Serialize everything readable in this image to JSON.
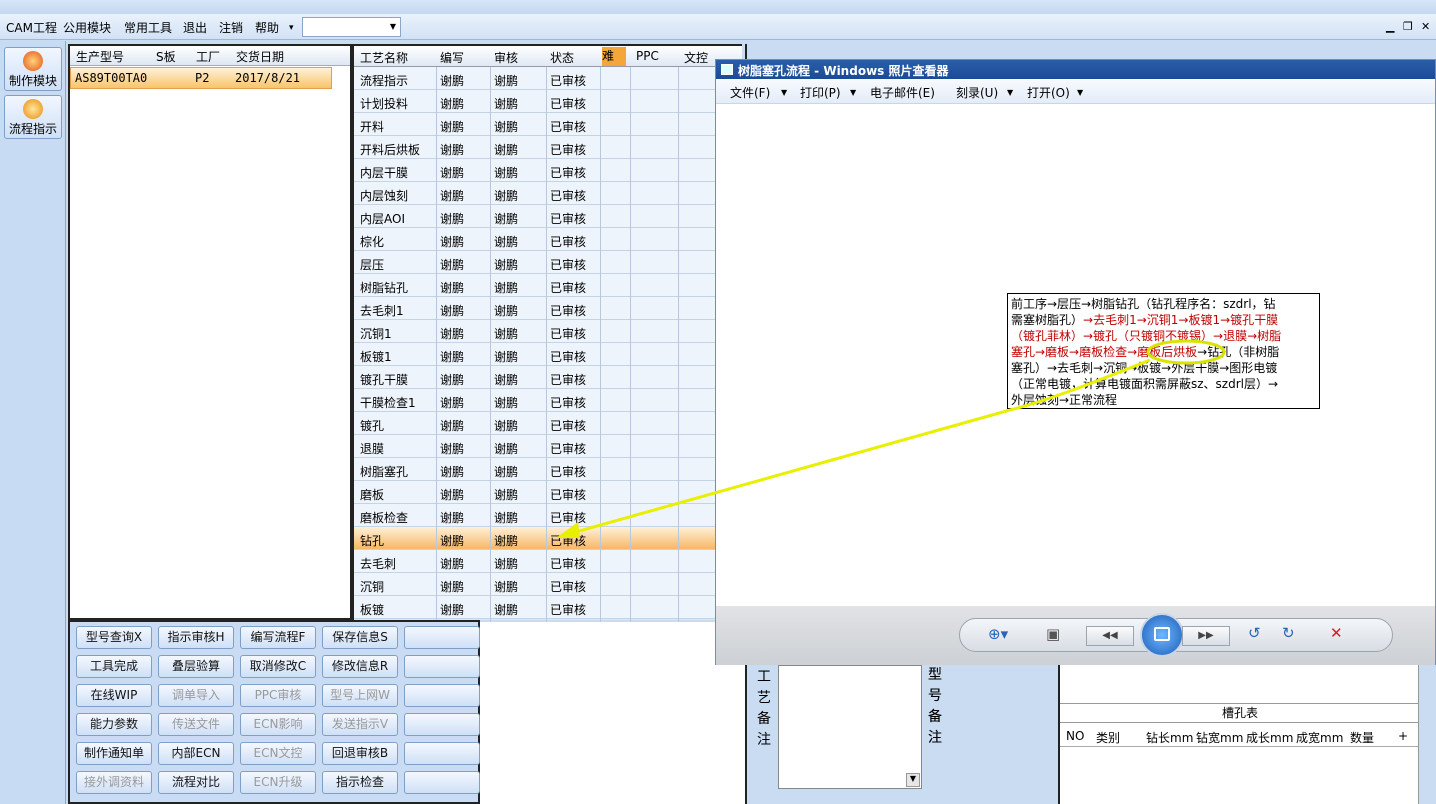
{
  "menubar": {
    "items": [
      "CAM工程",
      "公用模块",
      "常用工具",
      "退出",
      "注销",
      "帮助"
    ]
  },
  "rail": {
    "buttons": [
      "制作模块",
      "流程指示"
    ]
  },
  "orders": {
    "headers": [
      "生产型号",
      "S板",
      "工厂",
      "交货日期"
    ],
    "row": {
      "model": "AS89T00TA0",
      "factory": "P2",
      "date": "2017/8/21"
    }
  },
  "process": {
    "headers": [
      "工艺名称",
      "编写",
      "审核",
      "状态",
      "难",
      "PPC",
      "文控"
    ],
    "rows": [
      {
        "name": "流程指示",
        "writer": "谢鹏",
        "reviewer": "谢鹏",
        "status": "已审核"
      },
      {
        "name": "计划投料",
        "writer": "谢鹏",
        "reviewer": "谢鹏",
        "status": "已审核"
      },
      {
        "name": "开料",
        "writer": "谢鹏",
        "reviewer": "谢鹏",
        "status": "已审核"
      },
      {
        "name": "开料后烘板",
        "writer": "谢鹏",
        "reviewer": "谢鹏",
        "status": "已审核"
      },
      {
        "name": "内层干膜",
        "writer": "谢鹏",
        "reviewer": "谢鹏",
        "status": "已审核"
      },
      {
        "name": "内层蚀刻",
        "writer": "谢鹏",
        "reviewer": "谢鹏",
        "status": "已审核"
      },
      {
        "name": "内层AOI",
        "writer": "谢鹏",
        "reviewer": "谢鹏",
        "status": "已审核"
      },
      {
        "name": "棕化",
        "writer": "谢鹏",
        "reviewer": "谢鹏",
        "status": "已审核"
      },
      {
        "name": "层压",
        "writer": "谢鹏",
        "reviewer": "谢鹏",
        "status": "已审核"
      },
      {
        "name": "树脂钻孔",
        "writer": "谢鹏",
        "reviewer": "谢鹏",
        "status": "已审核"
      },
      {
        "name": "去毛刺1",
        "writer": "谢鹏",
        "reviewer": "谢鹏",
        "status": "已审核"
      },
      {
        "name": "沉铜1",
        "writer": "谢鹏",
        "reviewer": "谢鹏",
        "status": "已审核"
      },
      {
        "name": "板镀1",
        "writer": "谢鹏",
        "reviewer": "谢鹏",
        "status": "已审核"
      },
      {
        "name": "镀孔干膜",
        "writer": "谢鹏",
        "reviewer": "谢鹏",
        "status": "已审核"
      },
      {
        "name": "干膜检查1",
        "writer": "谢鹏",
        "reviewer": "谢鹏",
        "status": "已审核"
      },
      {
        "name": "镀孔",
        "writer": "谢鹏",
        "reviewer": "谢鹏",
        "status": "已审核"
      },
      {
        "name": "退膜",
        "writer": "谢鹏",
        "reviewer": "谢鹏",
        "status": "已审核"
      },
      {
        "name": "树脂塞孔",
        "writer": "谢鹏",
        "reviewer": "谢鹏",
        "status": "已审核"
      },
      {
        "name": "磨板",
        "writer": "谢鹏",
        "reviewer": "谢鹏",
        "status": "已审核"
      },
      {
        "name": "磨板检查",
        "writer": "谢鹏",
        "reviewer": "谢鹏",
        "status": "已审核"
      },
      {
        "name": "钻孔",
        "writer": "谢鹏",
        "reviewer": "谢鹏",
        "status": "已审核"
      },
      {
        "name": "去毛刺",
        "writer": "谢鹏",
        "reviewer": "谢鹏",
        "status": "已审核"
      },
      {
        "name": "沉铜",
        "writer": "谢鹏",
        "reviewer": "谢鹏",
        "status": "已审核"
      },
      {
        "name": "板镀",
        "writer": "谢鹏",
        "reviewer": "谢鹏",
        "status": "已审核"
      }
    ]
  },
  "buttons": [
    [
      "型号查询X",
      "指示审核H",
      "编写流程F",
      "保存信息S",
      ""
    ],
    [
      "工具完成",
      "叠层验算",
      "取消修改C",
      "修改信息R",
      ""
    ],
    [
      "在线WIP",
      "调单导入",
      "PPC审核",
      "型号上网W",
      ""
    ],
    [
      "能力参数",
      "传送文件",
      "ECN影响",
      "发送指示V",
      ""
    ],
    [
      "制作通知单",
      "内部ECN",
      "ECN文控",
      "回退审核B",
      ""
    ],
    [
      "接外调资料",
      "流程对比",
      "ECN升级",
      "指示检查",
      ""
    ]
  ],
  "viewer": {
    "title": "树脂塞孔流程 - Windows 照片查看器",
    "menu": [
      "文件(F)",
      "打印(P)",
      "电子邮件(E)",
      "刻录(U)",
      "打开(O)"
    ]
  },
  "flow_text": {
    "line1": "前工序→层压→树脂钻孔（钻孔程序名：szdrl，钻",
    "line2a": "需塞树脂孔）",
    "line2b": "→去毛刺1→沉铜1→板镀1→镀孔干膜",
    "line3": "（镀孔菲林）→镀孔（只镀铜不镀锡）→退膜→树脂",
    "line4a": "塞孔→磨板→磨板检查→磨板后烘板",
    "line4b": "→钻孔（非树脂",
    "line5": "塞孔）→去毛刺→沉铜→板镀→外层干膜→图形电镀",
    "line6": "（正常电镀，计算电镀面积需屏蔽sz、szdrl层）→",
    "line7": "外层蚀刻→正常流程"
  },
  "bottom": {
    "label_left": [
      "工",
      "艺",
      "备",
      "注"
    ],
    "label_mid": [
      "型",
      "号",
      "备",
      "注"
    ],
    "slot_title": "槽孔表",
    "slot_headers": [
      "NO",
      "类别",
      "钻长mm",
      "钻宽mm",
      "成长mm",
      "成宽mm",
      "数量",
      "+"
    ]
  },
  "colors": {
    "selected_row": "#f8c46a",
    "flow_red": "#c00000",
    "arrow": "#e8f000"
  }
}
